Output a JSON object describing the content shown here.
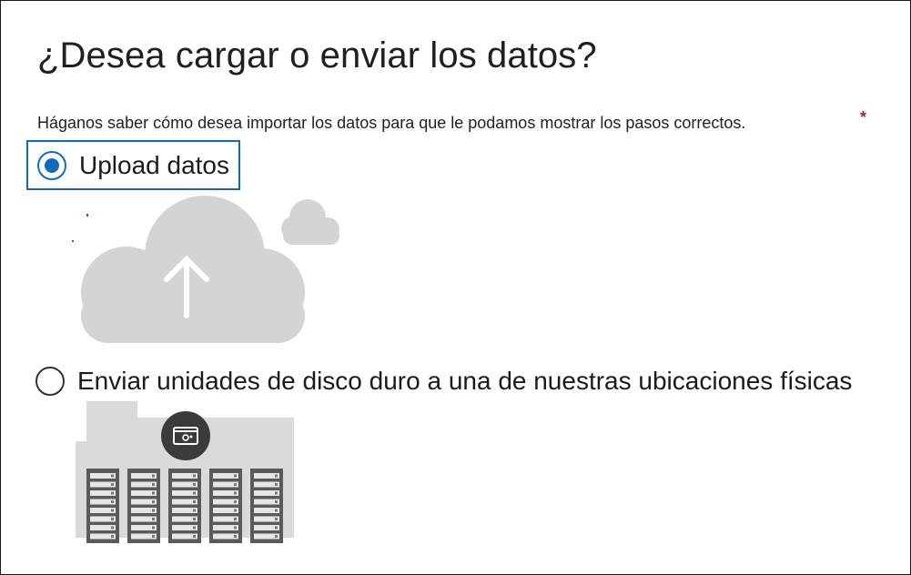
{
  "dialog": {
    "title": "¿Desea cargar o enviar los datos?",
    "subtitle": "Háganos saber cómo desea importar los datos para que le podamos mostrar los pasos correctos.",
    "required_marker": "*"
  },
  "options": [
    {
      "label": "Upload datos",
      "selected": true,
      "illustration_icon": "cloud-upload-icon"
    },
    {
      "label": "Enviar unidades de disco duro a una de nuestras ubicaciones físicas",
      "selected": false,
      "illustration_icon": "datacenter-servers-icon"
    }
  ],
  "colors": {
    "accent": "#0f6cbd",
    "illustration_gray": "#d4d4d4",
    "badge_dark": "#3b3b3b"
  }
}
